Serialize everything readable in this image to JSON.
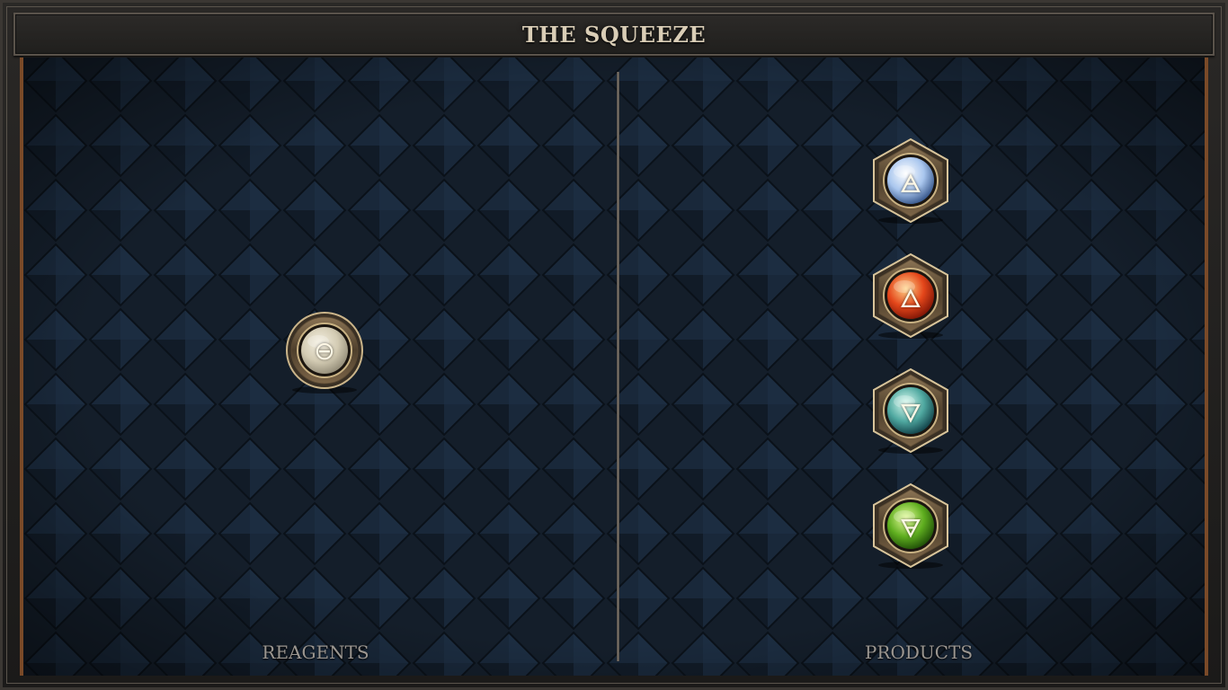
{
  "title": "THE SQUEEZE",
  "reagents": {
    "label": "REAGENTS",
    "items": [
      {
        "name": "salt",
        "glyph": "⊖",
        "frame": "round",
        "orb_colors": [
          "#f4efe0",
          "#d3cbb3",
          "#8f8874"
        ]
      }
    ]
  },
  "products": {
    "label": "PRODUCTS",
    "items": [
      {
        "name": "air",
        "glyph": "🜁",
        "frame": "hex",
        "orb_colors": [
          "#ffffff",
          "#a9c6ee",
          "#2f4f84"
        ]
      },
      {
        "name": "fire",
        "glyph": "🜂",
        "frame": "hex",
        "orb_colors": [
          "#ffd58a",
          "#e4461a",
          "#7a1305"
        ]
      },
      {
        "name": "water",
        "glyph": "🜄",
        "frame": "hex",
        "orb_colors": [
          "#dffff3",
          "#4fa8a0",
          "#0f3c44"
        ]
      },
      {
        "name": "earth",
        "glyph": "🜃",
        "frame": "hex",
        "orb_colors": [
          "#e9ff9c",
          "#5fae1f",
          "#1c4a06"
        ]
      }
    ]
  },
  "colors": {
    "board_bg": "#15202c",
    "frame_wood": "#7a4a28",
    "bronze": "#b49a6e",
    "title_text": "#d9cdb6",
    "label_text": "#9b9690"
  }
}
